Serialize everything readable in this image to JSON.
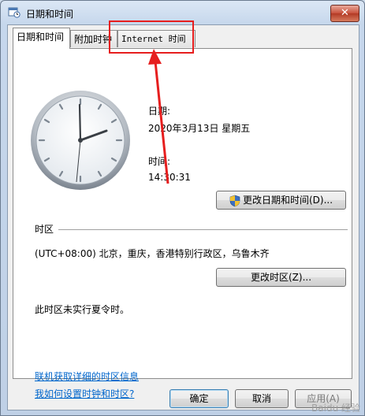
{
  "window": {
    "title": "日期和时间",
    "close_label": "✕",
    "icon": "calendar-clock-icon"
  },
  "tabs": [
    {
      "label": "日期和时间",
      "active": true
    },
    {
      "label": "附加时钟",
      "active": false
    },
    {
      "label": "Internet 时间",
      "active": false
    }
  ],
  "datetime": {
    "date_label": "日期:",
    "date_value": "2020年3月13日 星期五",
    "time_label": "时间:",
    "time_value": "14:30:31",
    "change_button": "更改日期和时间(D)..."
  },
  "timezone": {
    "section_label": "时区",
    "value": "(UTC+08:00) 北京，重庆，香港特别行政区，乌鲁木齐",
    "change_button": "更改时区(Z)...",
    "dst_note": "此时区未实行夏令时。"
  },
  "links": {
    "online_info": "联机获取详细的时区信息",
    "how_to": "我如何设置时钟和时区?"
  },
  "footer": {
    "ok": "确定",
    "cancel": "取消",
    "apply": "应用(A)"
  },
  "annotation": {
    "highlight_color": "#e61e1e"
  },
  "watermark": "Baidu 经验"
}
